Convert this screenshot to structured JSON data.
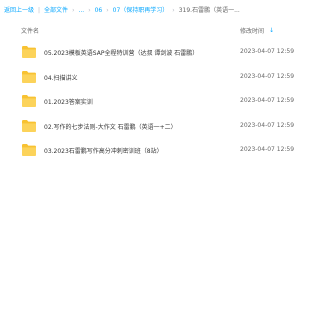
{
  "breadcrumb": {
    "back": "返回上一级",
    "sep": "|",
    "all_files": "全部文件",
    "ellipsis": "...",
    "crumb_06": "06",
    "crumb_07": "07（保持职再学习）",
    "current": "319.石雷鹏（英语一..."
  },
  "header": {
    "name_label": "文件名",
    "time_label": "修改时间",
    "sort_icon": "arrow-down-icon"
  },
  "accent_color": "#06a7ff",
  "folder_color": "#f8c232",
  "rows": [
    {
      "name": "05.2023模板英语SAP全程特训营（达叔 谭剑波 石雷鹏）",
      "time": "2023-04-07 12:59"
    },
    {
      "name": "04.扫描讲义",
      "time": "2023-04-07 12:59"
    },
    {
      "name": "01.2023答案实训",
      "time": "2023-04-07 12:59"
    },
    {
      "name": "02.写作的七步法则-大作文 石雷鹏（英语一+二）",
      "time": "2023-04-07 12:59"
    },
    {
      "name": "03.2023石雷鹏写作高分冲刺密训班（8站）",
      "time": "2023-04-07 12:59"
    }
  ]
}
